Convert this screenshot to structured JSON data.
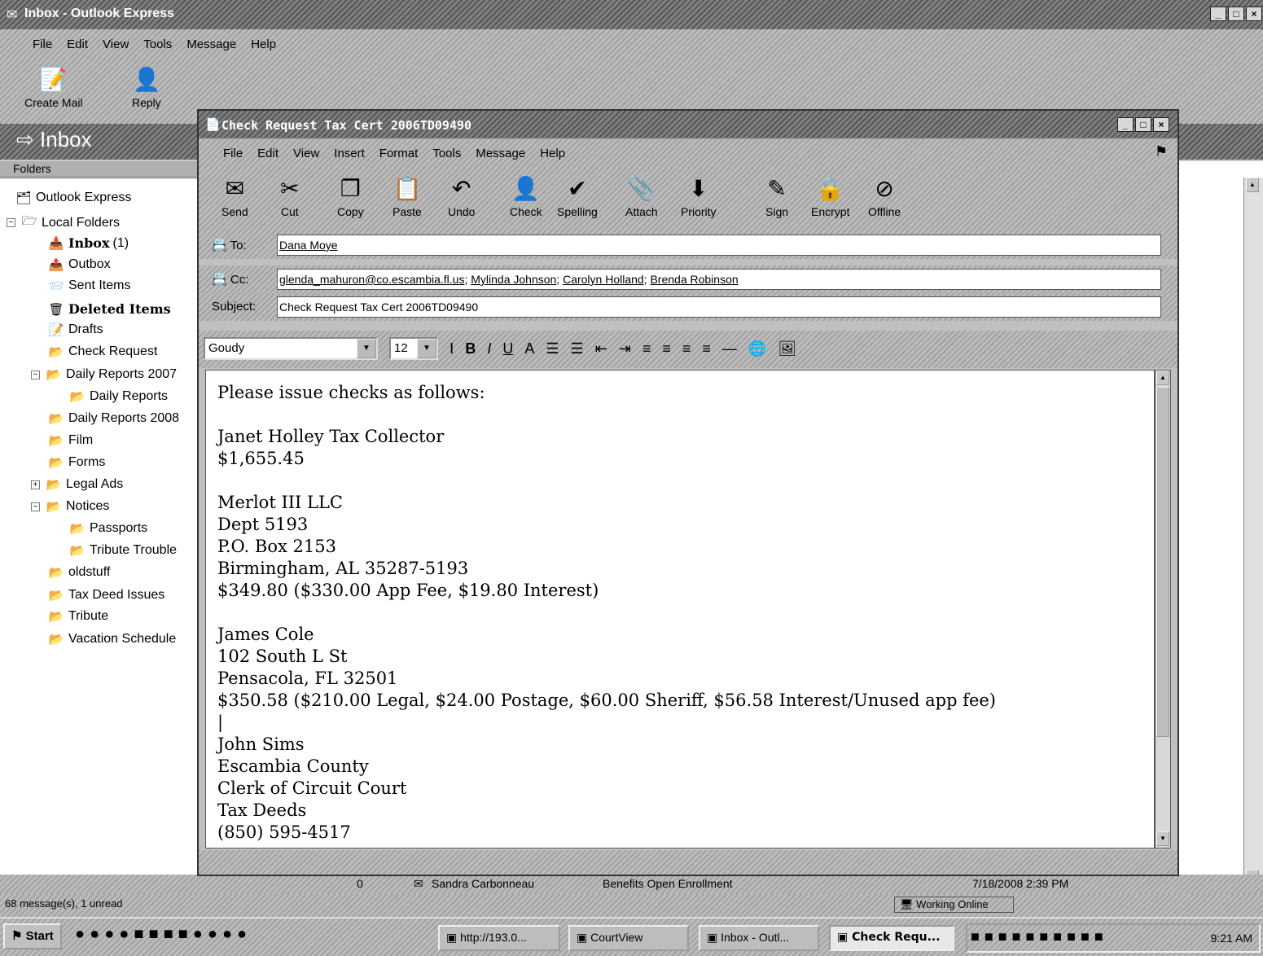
{
  "main_window": {
    "title": "Inbox - Outlook Express",
    "menu": [
      "File",
      "Edit",
      "View",
      "Tools",
      "Message",
      "Help"
    ],
    "toolbar": [
      {
        "label": "Create Mail",
        "icon": "create-mail-icon"
      },
      {
        "label": "Reply",
        "icon": "reply-icon"
      }
    ],
    "folder_header": "Inbox",
    "folders_label": "Folders",
    "folders": [
      {
        "label": "Outlook Express",
        "icon": "outlook-express-icon",
        "bold": false
      },
      {
        "label": "Local Folders",
        "icon": "local-folders-icon",
        "bold": false
      },
      {
        "label": "Inbox",
        "count": "(1)",
        "icon": "inbox-icon",
        "bold": true
      },
      {
        "label": "Outbox",
        "icon": "outbox-icon",
        "bold": false
      },
      {
        "label": "Sent Items",
        "icon": "sent-items-icon",
        "bold": false
      },
      {
        "label": "Deleted Items",
        "icon": "deleted-items-icon",
        "bold": true
      },
      {
        "label": "Drafts",
        "icon": "drafts-icon",
        "bold": false
      },
      {
        "label": "Check Request",
        "icon": "folder-icon",
        "bold": false
      },
      {
        "label": "Daily Reports 2007",
        "icon": "folder-icon",
        "bold": false
      },
      {
        "label": "Daily Reports",
        "icon": "folder-icon",
        "bold": false
      },
      {
        "label": "Daily Reports 2008",
        "icon": "folder-icon",
        "bold": false
      },
      {
        "label": "Film",
        "icon": "folder-icon",
        "bold": false
      },
      {
        "label": "Forms",
        "icon": "folder-icon",
        "bold": false
      },
      {
        "label": "Legal Ads",
        "icon": "folder-icon",
        "bold": false
      },
      {
        "label": "Notices",
        "icon": "folder-icon",
        "bold": false
      },
      {
        "label": "Passports",
        "icon": "folder-icon",
        "bold": false
      },
      {
        "label": "Tribute Trouble",
        "icon": "folder-icon",
        "bold": false
      },
      {
        "label": "oldstuff",
        "icon": "folder-icon",
        "bold": false
      },
      {
        "label": "Tax Deed Issues",
        "icon": "folder-icon",
        "bold": false
      },
      {
        "label": "Tribute",
        "icon": "folder-icon",
        "bold": false
      },
      {
        "label": "Vacation Schedule",
        "icon": "folder-icon",
        "bold": false
      }
    ],
    "message_row": {
      "from": "Sandra Carbonneau",
      "subject": "Benefits Open Enrollment",
      "received": "7/18/2008 2:39 PM"
    },
    "status": {
      "count": "68 message(s), 1 unread",
      "online": "Working Online"
    }
  },
  "compose": {
    "title": "Check Request Tax Cert 2006TD09490",
    "menu": [
      "File",
      "Edit",
      "View",
      "Insert",
      "Format",
      "Tools",
      "Message",
      "Help"
    ],
    "toolbar": [
      {
        "label": "Send",
        "icon": "send-icon"
      },
      {
        "label": "Cut",
        "icon": "cut-icon"
      },
      {
        "label": "Copy",
        "icon": "copy-icon"
      },
      {
        "label": "Paste",
        "icon": "paste-icon"
      },
      {
        "label": "Undo",
        "icon": "undo-icon"
      },
      {
        "label": "Check",
        "icon": "check-names-icon"
      },
      {
        "label": "Spelling",
        "icon": "spelling-icon"
      },
      {
        "label": "Attach",
        "icon": "attach-icon"
      },
      {
        "label": "Priority",
        "icon": "priority-icon"
      },
      {
        "label": "Sign",
        "icon": "sign-icon"
      },
      {
        "label": "Encrypt",
        "icon": "encrypt-icon"
      },
      {
        "label": "Offline",
        "icon": "offline-icon"
      }
    ],
    "to_label": "To:",
    "to": [
      "Dana Moye"
    ],
    "cc_label": "Cc:",
    "cc": [
      "glenda_mahuron@co.escambia.fl.us",
      "Mylinda Johnson",
      "Carolyn Holland",
      "Brenda Robinson"
    ],
    "subject_label": "Subject:",
    "subject": "Check Request Tax Cert 2006TD09490",
    "font": "Goudy",
    "font_size": "12",
    "body": "Please issue checks as follows:\n\nJanet Holley Tax Collector\n$1,655.45\n\nMerlot III LLC\nDept 5193\nP.O. Box 2153\nBirmingham, AL 35287-5193\n$349.80 ($330.00 App Fee, $19.80 Interest)\n\nJames Cole\n102 South L St\nPensacola, FL 32501\n$350.58 ($210.00 Legal, $24.00 Postage, $60.00 Sheriff, $56.58 Interest/Unused app fee)\n|\nJohn Sims\nEscambia County\nClerk of Circuit Court\nTax Deeds\n(850) 595-4517"
  },
  "taskbar": {
    "start": "Start",
    "buttons": [
      {
        "label": "http://193.0...",
        "active": false
      },
      {
        "label": "CourtView",
        "active": false
      },
      {
        "label": "Inbox - Outl...",
        "active": false
      },
      {
        "label": "Check Requ...",
        "active": true
      }
    ],
    "clock": "9:21 AM"
  }
}
